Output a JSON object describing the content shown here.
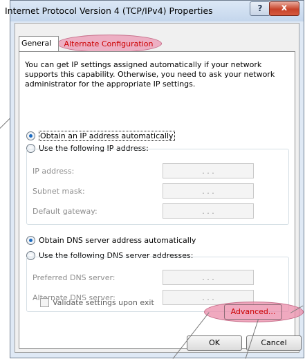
{
  "window": {
    "title": "Internet Protocol Version 4 (TCP/IPv4) Properties",
    "help_label": "?",
    "close_label": "x"
  },
  "tabs": [
    {
      "label": "General"
    },
    {
      "label": "Alternate Configuration"
    }
  ],
  "description": "You can get IP settings assigned automatically if your network supports this capability. Otherwise, you need to ask your network administrator for the appropriate IP settings.",
  "ip_settings": {
    "auto_label": "Obtain an IP address automatically",
    "manual_label": "Use the following IP address:",
    "fields": [
      {
        "label": "IP address:",
        "value": ".   .   ."
      },
      {
        "label": "Subnet mask:",
        "value": ".   .   ."
      },
      {
        "label": "Default gateway:",
        "value": ".   .   ."
      }
    ]
  },
  "dns_settings": {
    "auto_label": "Obtain DNS server address automatically",
    "manual_label": "Use the following DNS server addresses:",
    "fields": [
      {
        "label": "Preferred DNS server:",
        "value": ".   .   ."
      },
      {
        "label": "Alternate DNS server:",
        "value": ".   .   ."
      }
    ]
  },
  "validate_label": "Validate settings upon exit",
  "buttons": {
    "advanced": "Advanced...",
    "ok": "OK",
    "cancel": "Cancel"
  },
  "colors": {
    "highlight": "#eb8caa",
    "accent_text": "#cc0000"
  }
}
